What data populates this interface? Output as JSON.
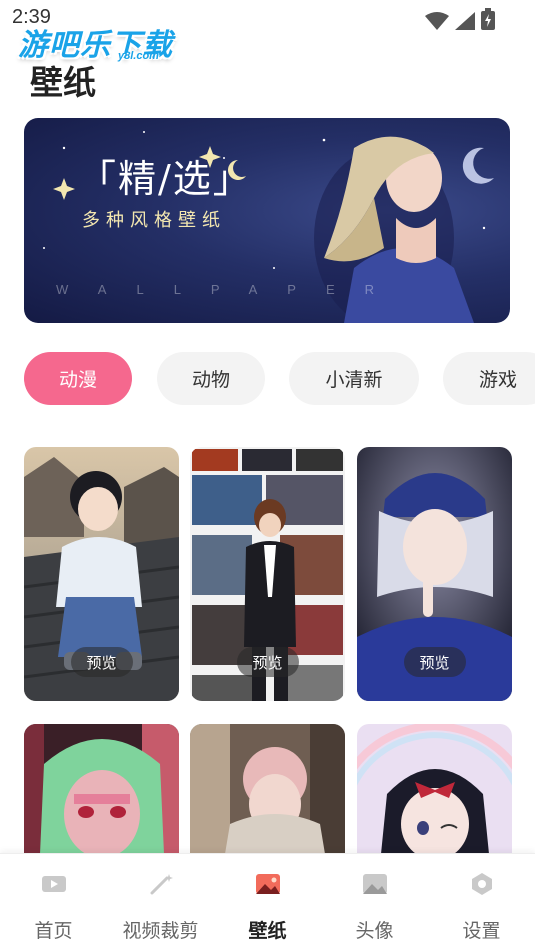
{
  "status_bar": {
    "time": "2:39"
  },
  "watermark": {
    "text": "游吧乐下载",
    "sub": "y8l.com"
  },
  "header": {
    "title": "壁纸"
  },
  "banner": {
    "title": "「精/选」",
    "subtitle": "多种风格壁纸",
    "word": "WALLPAPER"
  },
  "categories": [
    {
      "label": "动漫",
      "active": true
    },
    {
      "label": "动物",
      "active": false
    },
    {
      "label": "小清新",
      "active": false
    },
    {
      "label": "游戏",
      "active": false
    }
  ],
  "cards": [
    {
      "preview_label": "预览"
    },
    {
      "preview_label": "预览"
    },
    {
      "preview_label": "预览"
    }
  ],
  "bottom_nav": [
    {
      "label": "首页",
      "icon": "video-play-icon",
      "active": false
    },
    {
      "label": "视频裁剪",
      "icon": "magic-wand-icon",
      "active": false
    },
    {
      "label": "壁纸",
      "icon": "picture-icon",
      "active": true
    },
    {
      "label": "头像",
      "icon": "avatar-image-icon",
      "active": false
    },
    {
      "label": "设置",
      "icon": "gear-icon",
      "active": false
    }
  ],
  "colors": {
    "accent": "#f5688e",
    "tab_bg": "#f3f3f3",
    "watermark": "#1aa3e8"
  }
}
